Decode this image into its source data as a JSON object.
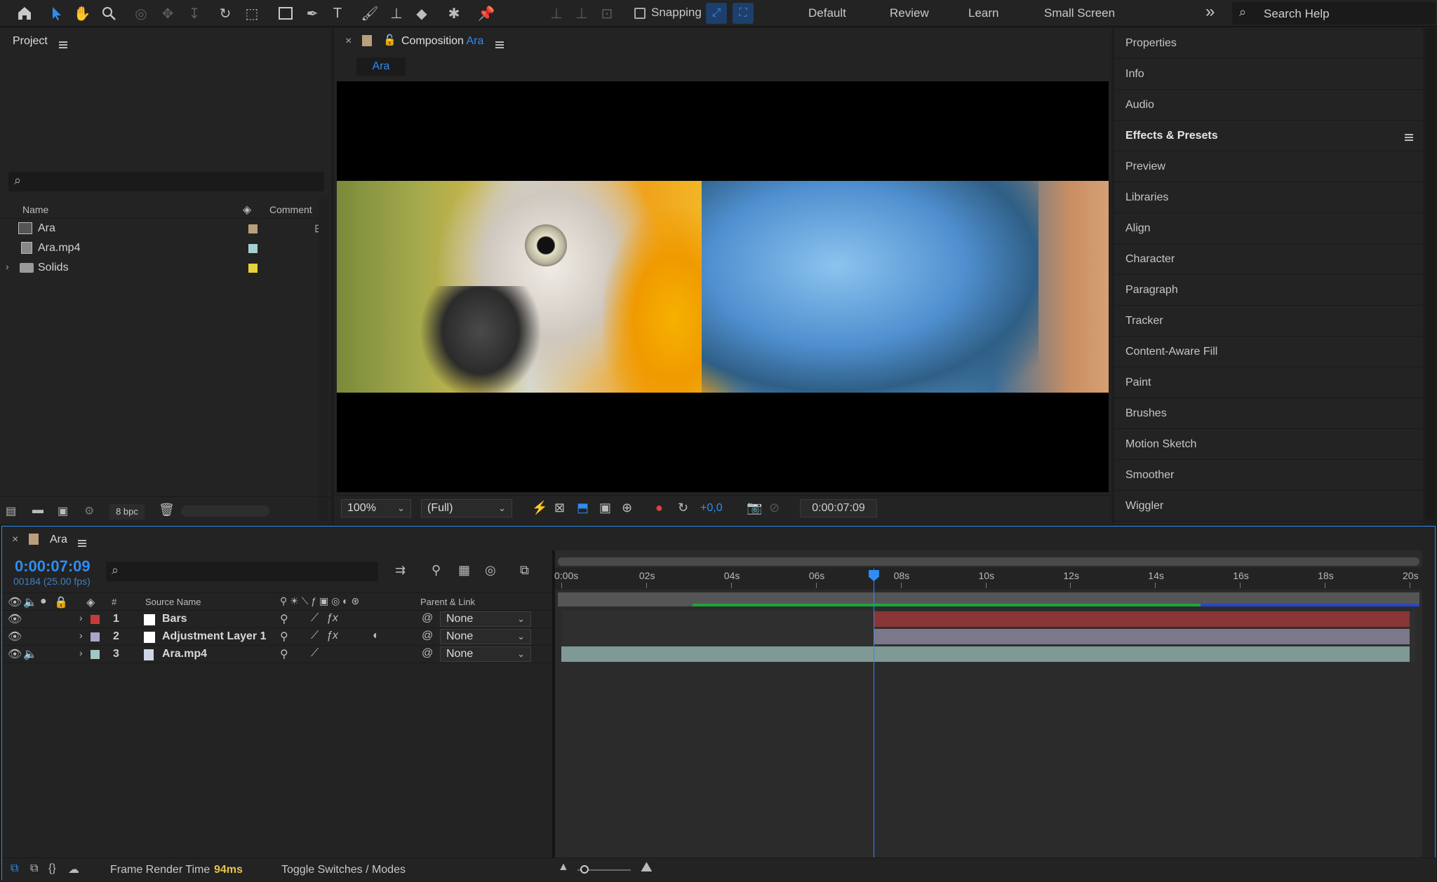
{
  "toolbar": {
    "snapping_label": "Snapping",
    "workspaces": [
      "Default",
      "Review",
      "Learn",
      "Small Screen"
    ],
    "more_glyph": "»",
    "search_placeholder": "Search Help"
  },
  "project": {
    "title": "Project",
    "search_placeholder": "",
    "columns": {
      "name": "Name",
      "comment": "Comment"
    },
    "items": [
      {
        "name": "Ara",
        "icon": "composition-icon",
        "label_color": "#b9a07a"
      },
      {
        "name": "Ara.mp4",
        "icon": "footage-icon",
        "label_color": "#a3d0d0"
      },
      {
        "name": "Solids",
        "icon": "folder-icon",
        "label_color": "#e6d23c"
      }
    ],
    "bpc": "8 bpc"
  },
  "composition": {
    "title_prefix": "Composition",
    "title_name": "Ara",
    "breadcrumb": "Ara",
    "zoom": "100%",
    "resolution": "(Full)",
    "exposure": "+0,0",
    "timecode": "0:00:07:09"
  },
  "right_panels": [
    "Properties",
    "Info",
    "Audio",
    "Effects & Presets",
    "Preview",
    "Libraries",
    "Align",
    "Character",
    "Paragraph",
    "Tracker",
    "Content-Aware Fill",
    "Paint",
    "Brushes",
    "Motion Sketch",
    "Smoother",
    "Wiggler"
  ],
  "timeline": {
    "tab": "Ara",
    "timecode": "0:00:07:09",
    "frame_info": "00184 (25.00 fps)",
    "columns": {
      "num": "#",
      "source": "Source Name",
      "parent": "Parent & Link"
    },
    "layers": [
      {
        "num": "1",
        "name": "Bars",
        "label_color": "#c73a3a",
        "parent": "None",
        "fx": true,
        "bar_color": "#8a3636",
        "start_s": 7.36
      },
      {
        "num": "2",
        "name": "Adjustment Layer 1",
        "label_color": "#a8a6c9",
        "parent": "None",
        "fx": true,
        "bar_color": "#7a7889",
        "start_s": 7.36
      },
      {
        "num": "3",
        "name": "Ara.mp4",
        "label_color": "#a3c7c2",
        "parent": "None",
        "fx": false,
        "bar_color": "#7f9994",
        "start_s": 0
      }
    ],
    "ruler_labels": [
      "0:00s",
      "02s",
      "04s",
      "06s",
      "08s",
      "10s",
      "12s",
      "14s",
      "16s",
      "18s",
      "20s"
    ],
    "duration_s": 20,
    "playhead_s": 7.36,
    "footer": {
      "render_label": "Frame Render Time",
      "render_value": "94ms",
      "toggle_label": "Toggle Switches / Modes"
    }
  },
  "colors": {
    "accent": "#2f8cf2",
    "panel": "#232323",
    "border": "#111111"
  }
}
